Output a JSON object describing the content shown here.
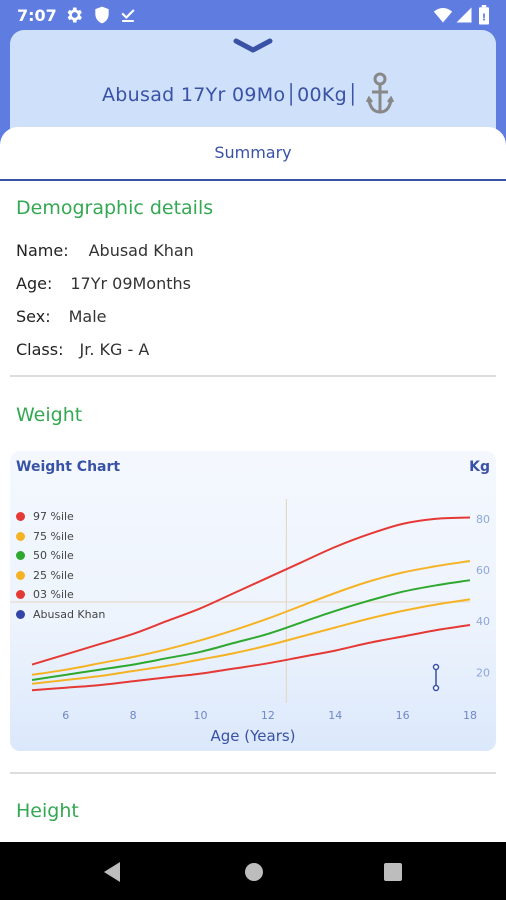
{
  "status": {
    "time": "7:07",
    "left_icons": [
      "settings-icon",
      "shield-icon",
      "download-done-icon"
    ],
    "right_icons": [
      "wifi-icon",
      "signal-icon",
      "battery-icon"
    ]
  },
  "header": {
    "patient_summary": "Abusad  17Yr 09Mo│00Kg│",
    "expand_icon": "chevron-down-icon",
    "pin_icon": "anchor-icon"
  },
  "tab": {
    "label": "Summary"
  },
  "demographics": {
    "title": "Demographic details",
    "rows": [
      {
        "label": "Name:",
        "value": "Abusad  Khan"
      },
      {
        "label": "Age:",
        "value": "17Yr 09Months"
      },
      {
        "label": "Sex:",
        "value": "Male"
      },
      {
        "label": "Class:",
        "value": "Jr. KG - A"
      }
    ]
  },
  "weight": {
    "title": "Weight"
  },
  "height": {
    "title": "Height"
  },
  "colors": {
    "accent": "#3952a5",
    "green": "#34a853",
    "p97": "#e53935",
    "p75": "#f5b324",
    "p50": "#2fa82f",
    "p25": "#f5b324",
    "p03": "#e53935",
    "patient": "#3345a8"
  },
  "chart_data": {
    "type": "line",
    "title": "Weight Chart",
    "unit": "Kg",
    "xlabel": "Age (Years)",
    "x_ticks": [
      6,
      8,
      10,
      12,
      14,
      16,
      18
    ],
    "y_ticks": [
      20,
      40,
      60,
      80
    ],
    "xlim": [
      5,
      18
    ],
    "ylim": [
      8,
      94
    ],
    "x": [
      5,
      6,
      7,
      8,
      9,
      10,
      11,
      12,
      13,
      14,
      15,
      16,
      17,
      18
    ],
    "series": [
      {
        "name": "97 %ile",
        "color": "#e53935",
        "values": [
          23,
          27,
          31,
          35,
          40,
          45,
          51,
          57,
          63,
          69,
          74,
          78,
          80,
          80.5
        ]
      },
      {
        "name": "75 %ile",
        "color": "#f5b324",
        "values": [
          19,
          21,
          23.5,
          26,
          29,
          32.5,
          36.5,
          41,
          46,
          51,
          55.5,
          59,
          61.5,
          63.5
        ]
      },
      {
        "name": "50 %ile",
        "color": "#2fa82f",
        "values": [
          17,
          19,
          21,
          23,
          25.5,
          28,
          31.5,
          35,
          39.5,
          44,
          48,
          51.5,
          54,
          56
        ]
      },
      {
        "name": "25 %ile",
        "color": "#f5b324",
        "values": [
          15.5,
          17,
          18.5,
          20.5,
          22.5,
          25,
          27.5,
          30.5,
          34,
          37.5,
          41,
          44,
          46.5,
          48.5
        ]
      },
      {
        "name": "03 %ile",
        "color": "#e53935",
        "values": [
          13,
          14,
          15,
          16.5,
          18,
          19.5,
          21.5,
          23.5,
          26,
          28.5,
          31.5,
          34,
          36.5,
          38.5
        ]
      },
      {
        "name": "Abusad  Khan",
        "color": "#3345a8",
        "values": []
      }
    ],
    "crosshair": {
      "x": 12.55,
      "y": 47.5
    },
    "grid": false,
    "legend": "top-left"
  }
}
